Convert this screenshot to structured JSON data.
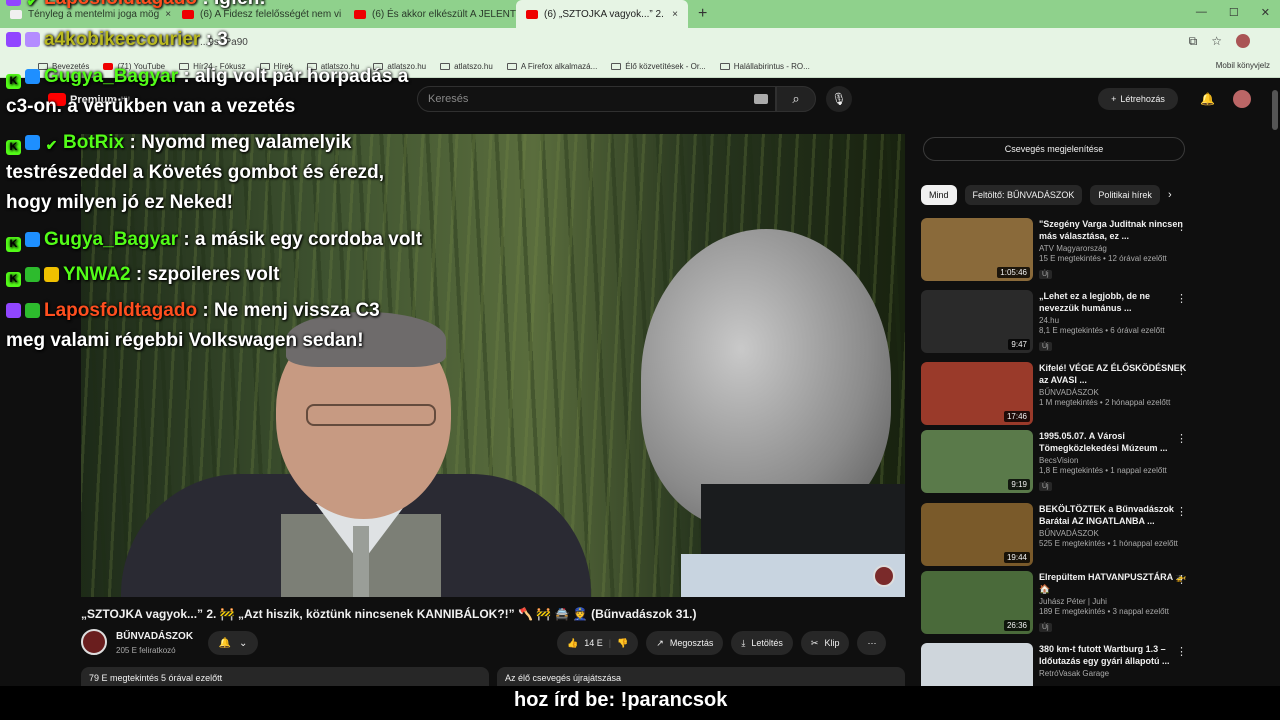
{
  "browser": {
    "tabs": [
      {
        "label": "Tényleg a mentelmi joga mög"
      },
      {
        "label": "(6) A Fidesz felelősségét nem vi"
      },
      {
        "label": "(6) És akkor elkészült A JELENTÉ"
      },
      {
        "label": "(6) „SZTOJKA vagyok...” 2."
      }
    ],
    "new_tab": "+",
    "url": "...9s4Pa90",
    "bookmarks": [
      "Bevezetés",
      "(71) YouTube",
      "Hír24 - Fókusz",
      "Hírek",
      "atlatszo.hu",
      "atlatszo.hu",
      "atlatszo.hu",
      "A Firefox alkalmazá...",
      "Élő közvetítések - Or...",
      "Halállabirintus - RO..."
    ],
    "bookmarks_right": "Mobil könyvjelz"
  },
  "youtube": {
    "premium": "Premium",
    "premium_sup": "HU",
    "search_placeholder": "Keresés",
    "create_label": "Létrehozás"
  },
  "chat": [
    {
      "user": "Laposfoldtagado",
      "text": " : Igfen!",
      "user_color": "#ff4f1f"
    },
    {
      "user": "a4kobikeecourier",
      "text": " : 3",
      "user_color": "#b9b91f"
    },
    {
      "user": "Gugya_Bagyar",
      "text": " : alig volt pár horpadás a",
      "user_color": "#53fc18"
    },
    {
      "cont": "c3-on. a verükben van a vezetés"
    },
    {
      "user": "BotRix",
      "text": " : Nyomd meg valamelyik",
      "user_color": "#53fc18"
    },
    {
      "cont": "testrészeddel a Követés gombot és érezd,"
    },
    {
      "cont": "hogy milyen jó ez Neked!"
    },
    {
      "user": "Gugya_Bagyar",
      "text": " : a másik egy cordoba volt",
      "user_color": "#53fc18"
    },
    {
      "user": "YNWA2",
      "text": " : szpoileres volt",
      "user_color": "#53fc18"
    },
    {
      "user": "Laposfoldtagado",
      "text": " : Ne menj vissza C3",
      "user_color": "#ff4f1f"
    },
    {
      "cont": "meg valami régebbi Volkswagen sedan!"
    }
  ],
  "sidebar": {
    "chat_button": "Csevegés megjelenítése",
    "chips": [
      "Mind",
      "Feltöltő: BŰNVADÁSZOK",
      "Politikai hírek"
    ],
    "recommendations": [
      {
        "title": "\"Szegény Varga Juditnak nincsen más választása, ez ...",
        "channel": "ATV Magyarország",
        "meta": "15 E megtekintés • 12 órával ezelőtt",
        "badge": "Új",
        "duration": "1:05:46",
        "thumb_color": "#8a6a3a"
      },
      {
        "title": "„Lehet ez a legjobb, de ne nevezzük humánus ...",
        "channel": "24.hu",
        "meta": "8,1 E megtekintés • 6 órával ezelőtt",
        "badge": "Új",
        "duration": "9:47",
        "thumb_color": "#2a2a2a"
      },
      {
        "title": "Kifelé! VÉGE AZ ÉLŐSKÖDÉSNEK az AVASI ...",
        "channel": "BŰNVADÁSZOK",
        "meta": "1 M megtekintés • 2 hónappal ezelőtt",
        "badge": "",
        "duration": "17:46",
        "thumb_color": "#9a3a2a"
      },
      {
        "title": "1995.05.07. A Városi Tömegközlekedési Múzeum ...",
        "channel": "BecsVision",
        "meta": "1,8 E megtekintés • 1 nappal ezelőtt",
        "badge": "Új",
        "duration": "9:19",
        "thumb_color": "#5a7a4a"
      },
      {
        "title": "BEKÖLTÖZTEK a Bűnvadászok Barátai AZ INGATLANBA ...",
        "channel": "BŰNVADÁSZOK",
        "meta": "525 E megtekintés • 1 hónappal ezelőtt",
        "badge": "",
        "duration": "19:44",
        "thumb_color": "#7a5a2a"
      },
      {
        "title": "Elrepültem HATVANPUSZTÁRA 🚁🏠",
        "channel": "Juhász Péter | Juhi",
        "meta": "189 E megtekintés • 3 nappal ezelőtt",
        "badge": "Új",
        "duration": "26:36",
        "thumb_color": "#4a6a3a"
      },
      {
        "title": "380 km-t futott Wartburg 1.3 – Időutazás egy gyári állapotú ...",
        "channel": "RetróVasak Garage",
        "meta": "",
        "badge": "",
        "duration": "",
        "thumb_color": "#cfd6dc"
      }
    ]
  },
  "video": {
    "title": "„SZTOJKA vagyok...” 2. 🚧 „Azt hiszik, köztünk nincsenek KANNIBÁLOK?!” 🪓 🚧 🚔 👮 (Bűnvadászok 31.)",
    "channel": "BŰNVADÁSZOK",
    "subscribers": "205 E feliratkozó",
    "likes": "14 E",
    "share": "Megosztás",
    "download": "Letöltés",
    "clip": "Klip",
    "views_meta": "79 E megtekintés  5 órával ezelőtt",
    "replay": "Az élő csevegés újrajátszása"
  },
  "subtitle": "hoz írd be: !parancsok"
}
